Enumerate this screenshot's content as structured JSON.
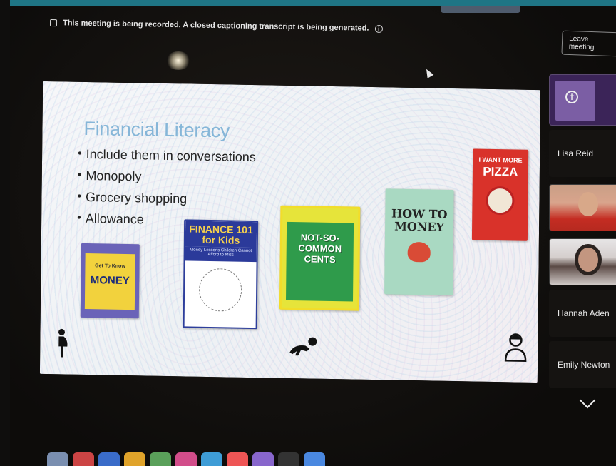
{
  "meeting": {
    "recording_notice": "This meeting is being recorded. A closed captioning transcript is being generated.",
    "leave_label": "Leave meeting"
  },
  "slide": {
    "title": "Financial Literacy",
    "bullets": [
      "Include them in conversations",
      "Monopoly",
      "Grocery shopping",
      "Allowance"
    ],
    "books": [
      {
        "title_small": "Get To Know",
        "title": "MONEY"
      },
      {
        "title": "FINANCE 101 for Kids",
        "subtitle": "Money Lessons Children Cannot Afford to Miss"
      },
      {
        "title": "NOT-SO-COMMON CENTS"
      },
      {
        "title": "HOW TO MONEY"
      },
      {
        "title_small": "I WANT MORE",
        "title": "PIZZA"
      }
    ]
  },
  "participants": [
    {
      "name": "Lisa Reid"
    },
    {
      "name": "Hannah Aden"
    },
    {
      "name": "Emily Newton"
    }
  ],
  "colors": {
    "title_blue": "#86b6d8",
    "desk_teal": "#1f7585",
    "leave_border": "#8a8a8a"
  },
  "icons": [
    "record-icon",
    "info-icon",
    "pregnant-figure-icon",
    "crawling-baby-icon",
    "adult-figure-icon",
    "chevron-down-icon"
  ]
}
